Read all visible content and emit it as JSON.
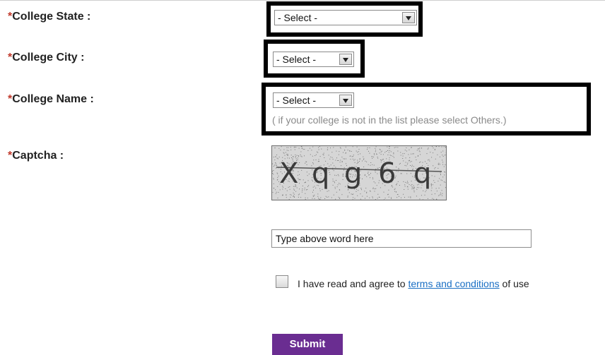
{
  "form": {
    "required_mark": "*",
    "state": {
      "label": "College State :",
      "selected": "- Select -"
    },
    "city": {
      "label": "College City :",
      "selected": "- Select -"
    },
    "name": {
      "label": "College Name :",
      "selected": "- Select -",
      "hint": "( if your college is not in the list please select Others.)"
    },
    "captcha": {
      "label": "Captcha :",
      "characters": [
        "X",
        "q",
        "g",
        "6",
        "q"
      ]
    },
    "captcha_input_placeholder": "Type above word here",
    "agree": {
      "prefix": "I have read and agree to",
      "link": "terms and conditions",
      "suffix": "of use",
      "checked": false
    },
    "submit_label": "Submit"
  },
  "colors": {
    "required": "#c0392b",
    "link": "#1a6fc4",
    "submit_bg": "#6a2d91",
    "highlight_border": "#000000"
  }
}
